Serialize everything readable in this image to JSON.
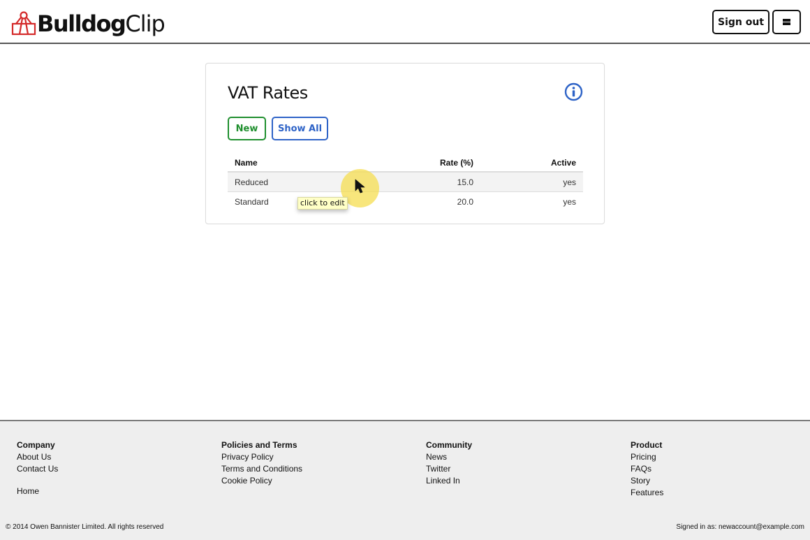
{
  "header": {
    "logo_bold": "Bulldog",
    "logo_light": "Clip",
    "logo_icon": "bulldog-clip-icon",
    "sign_out_label": "Sign out",
    "menu_icon": "hamburger-menu-icon"
  },
  "card": {
    "title": "VAT Rates",
    "info_icon": "info-circle-icon",
    "new_label": "New",
    "show_all_label": "Show All",
    "table": {
      "columns": [
        "Name",
        "Rate (%)",
        "Active"
      ],
      "rows": [
        {
          "name": "Reduced",
          "rate": "15.0",
          "active": "yes"
        },
        {
          "name": "Standard",
          "rate": "20.0",
          "active": "yes"
        }
      ]
    },
    "tooltip": "click to edit"
  },
  "colors": {
    "new_button": "#1f8f2e",
    "show_all_button": "#2e63c7",
    "logo_icon": "#d42a2a",
    "info_icon": "#2e63c7",
    "cursor_highlight": "#f6de50"
  },
  "footer": {
    "columns": [
      {
        "heading": "Company",
        "links": [
          "About Us",
          "Contact Us"
        ],
        "extra": "Home"
      },
      {
        "heading": "Policies and Terms",
        "links": [
          "Privacy Policy",
          "Terms and Conditions",
          "Cookie Policy"
        ]
      },
      {
        "heading": "Community",
        "links": [
          "News",
          "Twitter",
          "Linked In"
        ]
      },
      {
        "heading": "Product",
        "links": [
          "Pricing",
          "FAQs",
          "Story",
          "Features"
        ]
      }
    ],
    "copyright": "© 2014 Owen Bannister Limited. All rights reserved",
    "signed_in": "Signed in as: newaccount@example.com"
  }
}
